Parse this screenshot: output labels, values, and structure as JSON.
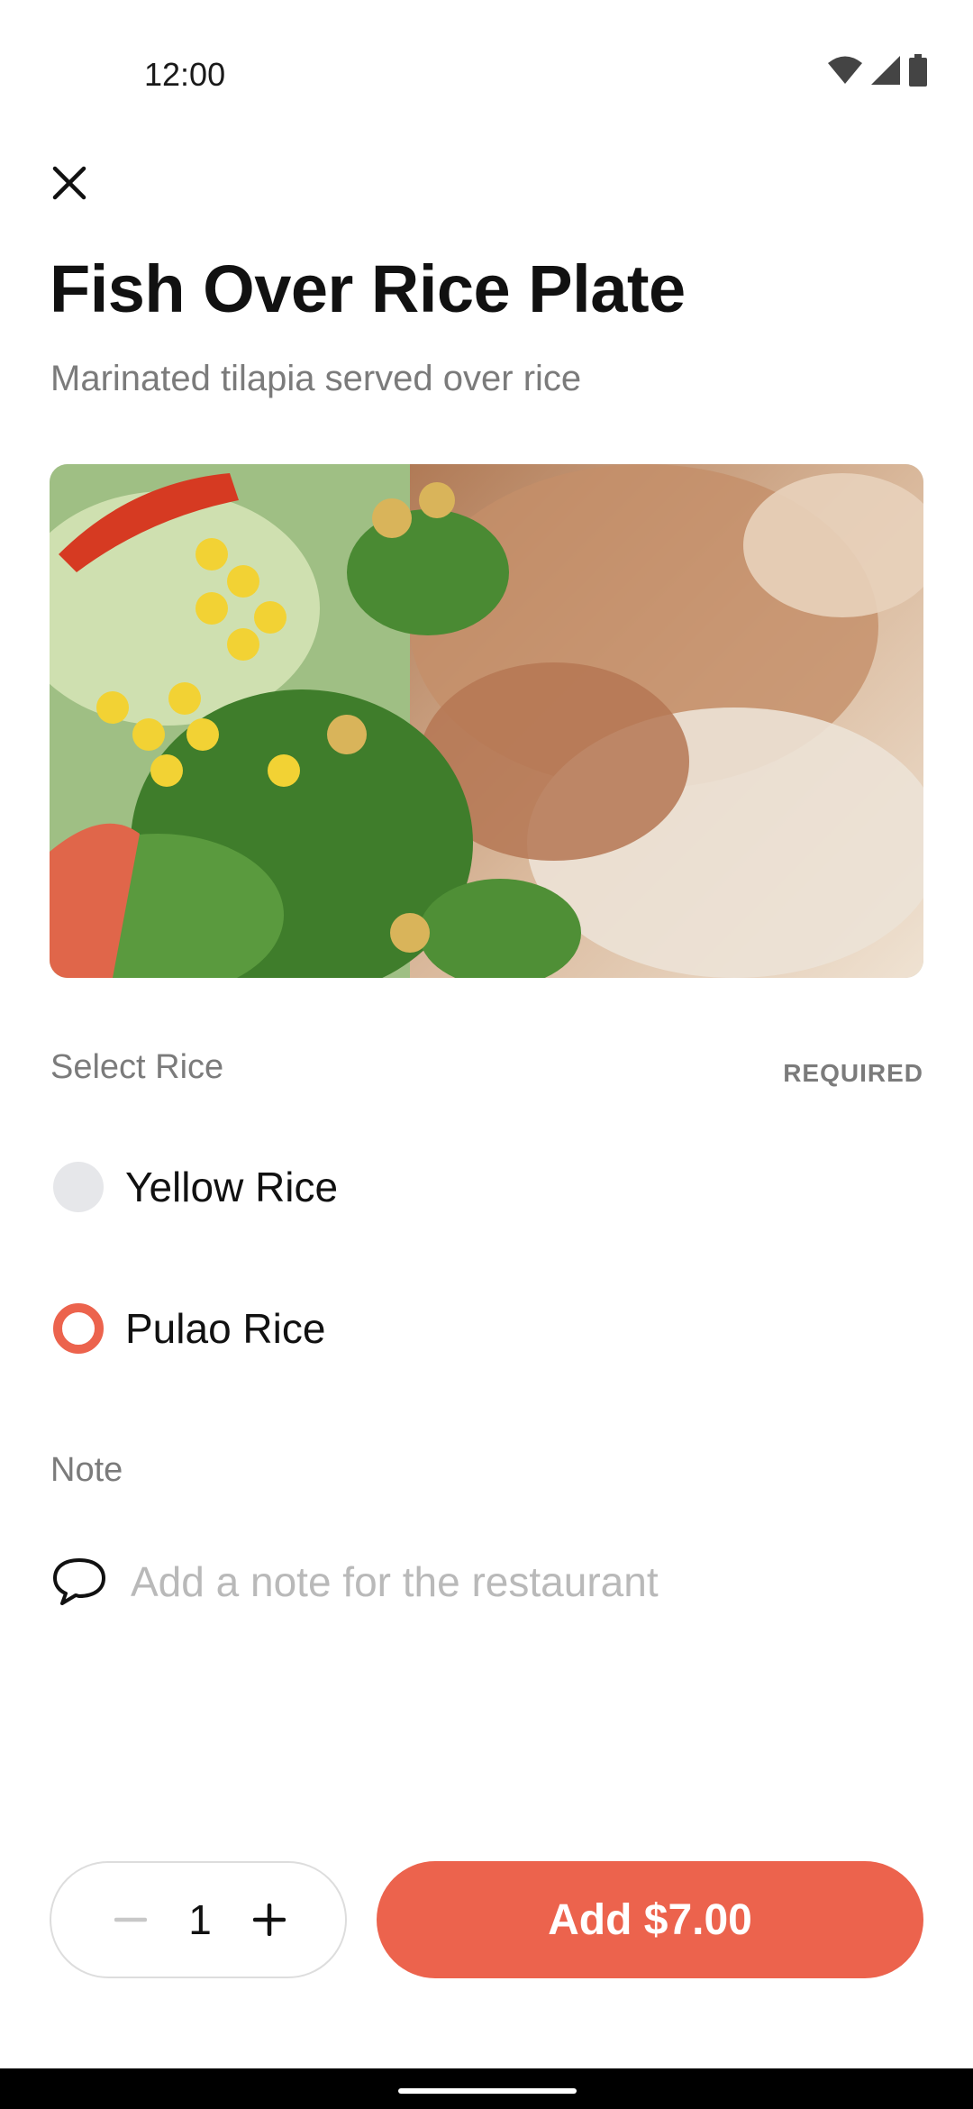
{
  "status_bar": {
    "time": "12:00"
  },
  "header": {
    "title": "Fish Over Rice Plate",
    "subtitle": "Marinated tilapia served over rice"
  },
  "rice_section": {
    "label": "Select Rice",
    "required_badge": "REQUIRED",
    "options": [
      {
        "label": "Yellow Rice",
        "selected": false
      },
      {
        "label": "Pulao Rice",
        "selected": true
      }
    ]
  },
  "note_section": {
    "label": "Note",
    "placeholder": "Add a note for the restaurant",
    "value": ""
  },
  "footer": {
    "quantity": "1",
    "add_label": "Add $7.00"
  },
  "colors": {
    "accent": "#ec634d",
    "muted_text": "#7b7b7b",
    "radio_unselected": "#e6e7ea"
  },
  "icons": [
    "close-icon",
    "wifi-icon",
    "signal-icon",
    "battery-icon",
    "chat-bubble-icon",
    "minus-icon",
    "plus-icon"
  ]
}
